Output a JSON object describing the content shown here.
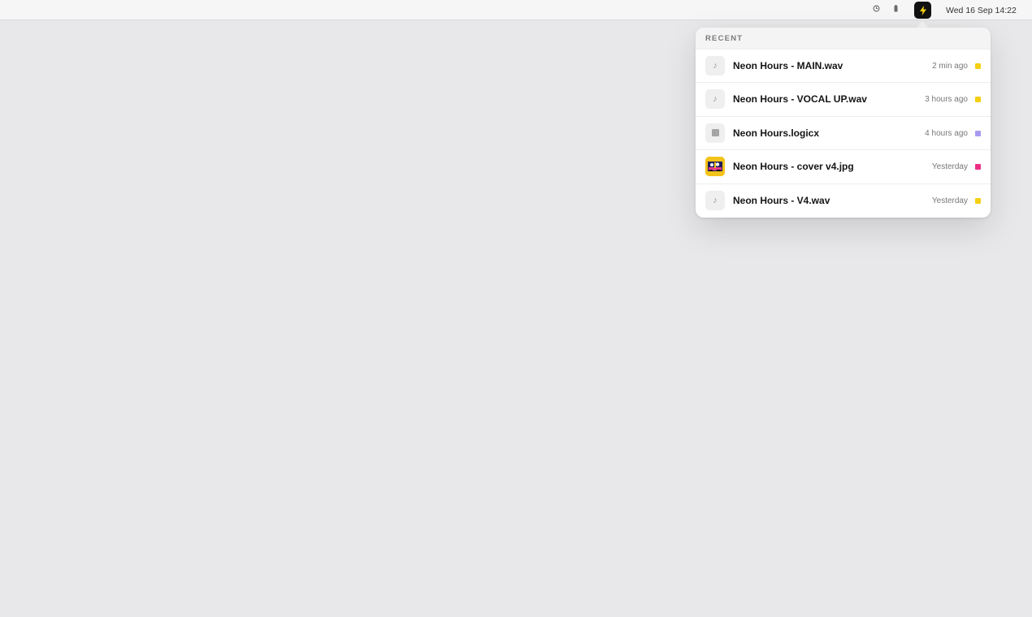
{
  "menubar": {
    "clock_icon": "history-icon",
    "battery_icon": "battery-icon",
    "app_icon": "lightning-icon",
    "datetime": "Wed 16 Sep 14:22"
  },
  "popover": {
    "header": "RECENT",
    "items": [
      {
        "name": "Neon Hours - MAIN.wav",
        "time": "2 min ago",
        "icon": "music-note-icon",
        "tag_color": "#f5cf13"
      },
      {
        "name": "Neon Hours - VOCAL UP.wav",
        "time": "3 hours ago",
        "icon": "music-note-icon",
        "tag_color": "#f5cf13"
      },
      {
        "name": "Neon Hours.logicx",
        "time": "4 hours ago",
        "icon": "project-file-icon",
        "tag_color": "#a99af0"
      },
      {
        "name": "Neon Hours - cover v4.jpg",
        "time": "Yesterday",
        "icon": "image-thumbnail",
        "tag_color": "#ee2f86"
      },
      {
        "name": "Neon Hours - V4.wav",
        "time": "Yesterday",
        "icon": "music-note-icon",
        "tag_color": "#f5cf13"
      }
    ]
  }
}
